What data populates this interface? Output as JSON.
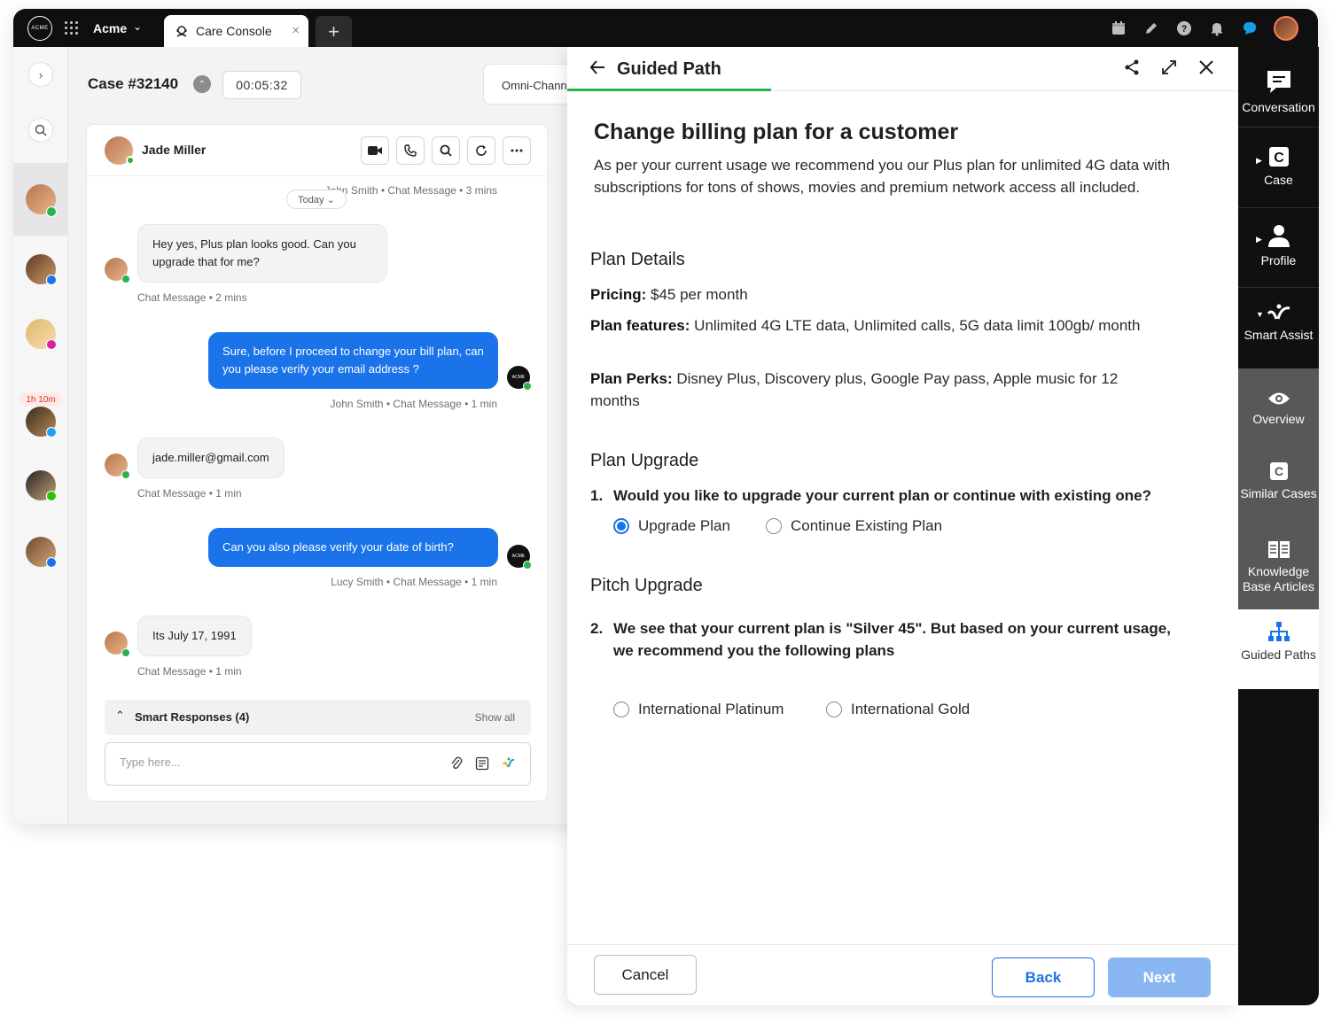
{
  "topbar": {
    "logo_text": "ACME",
    "org_name": "Acme",
    "tab_label": "Care Console",
    "tab_close": "×",
    "add_tab": "+"
  },
  "left_rail": {
    "collapse": "›",
    "timer_tag": "1h 10m"
  },
  "case": {
    "title": "Case #32140",
    "timer": "00:05:32",
    "omni_tab": "Omni-Channel"
  },
  "chat": {
    "contact_name": "Jade Miller",
    "today_pill": "Today ⌄",
    "messages": [
      {
        "meta": "John Smith • Chat Message • 3 mins"
      },
      {
        "text": "Hey yes, Plus plan looks good. Can you upgrade that for me?",
        "meta": "Chat Message • 2 mins"
      },
      {
        "text": "Sure, before I proceed to change your bill plan, can you please verify your email address ?",
        "meta": "John Smith • Chat Message • 1 min"
      },
      {
        "text": "jade.miller@gmail.com",
        "meta": "Chat Message • 1 min"
      },
      {
        "text": "Can you also please verify your date of birth?",
        "meta": "Lucy Smith • Chat Message • 1 min"
      },
      {
        "text": "Its July 17, 1991",
        "meta": "Chat Message • 1 min"
      }
    ],
    "smart_responses": "Smart Responses (4)",
    "show_all": "Show all",
    "composer_placeholder": "Type here..."
  },
  "guided_path": {
    "header_title": "Guided Path",
    "title": "Change billing plan for a customer",
    "intro": "As per your current usage we recommend you our Plus plan for unlimited 4G data with subscriptions for tons of shows, movies and premium network access all included.",
    "plan_details_heading": "Plan Details",
    "pricing_label": "Pricing:",
    "pricing_value": " $45 per month",
    "features_label": "Plan features:",
    "features_value": " Unlimited 4G LTE data, Unlimited calls, 5G data limit 100gb/ month",
    "perks_label": "Plan Perks:",
    "perks_value": " Disney Plus, Discovery plus, Google Pay pass, Apple music for 12 months",
    "upgrade_heading": "Plan Upgrade",
    "q1_num": "1.",
    "q1_text": "Would you like to upgrade your current plan or continue with existing one?",
    "q1_options": [
      "Upgrade Plan",
      "Continue Existing Plan"
    ],
    "q1_selected": "Upgrade Plan",
    "pitch_heading": "Pitch Upgrade",
    "q2_num": "2.",
    "q2_text": "We see that your current plan is \"Silver 45\". But based on your current usage, we recommend you the following plans",
    "q2_options": [
      "International Platinum",
      "International Gold"
    ],
    "cancel_label": "Cancel",
    "back_label": "Back",
    "next_label": "Next"
  },
  "right_sidebar": {
    "items": [
      {
        "label": "Conversation"
      },
      {
        "label": "Case"
      },
      {
        "label": "Profile"
      },
      {
        "label": "Smart Assist"
      },
      {
        "label": "Overview"
      },
      {
        "label": "Similar Cases"
      },
      {
        "label": "Knowledge Base Articles"
      },
      {
        "label": "Guided Paths"
      }
    ]
  },
  "colors": {
    "accent_blue": "#1a73e8",
    "whatsapp_green": "#2bb24c",
    "topbar_black": "#0f0f10"
  }
}
